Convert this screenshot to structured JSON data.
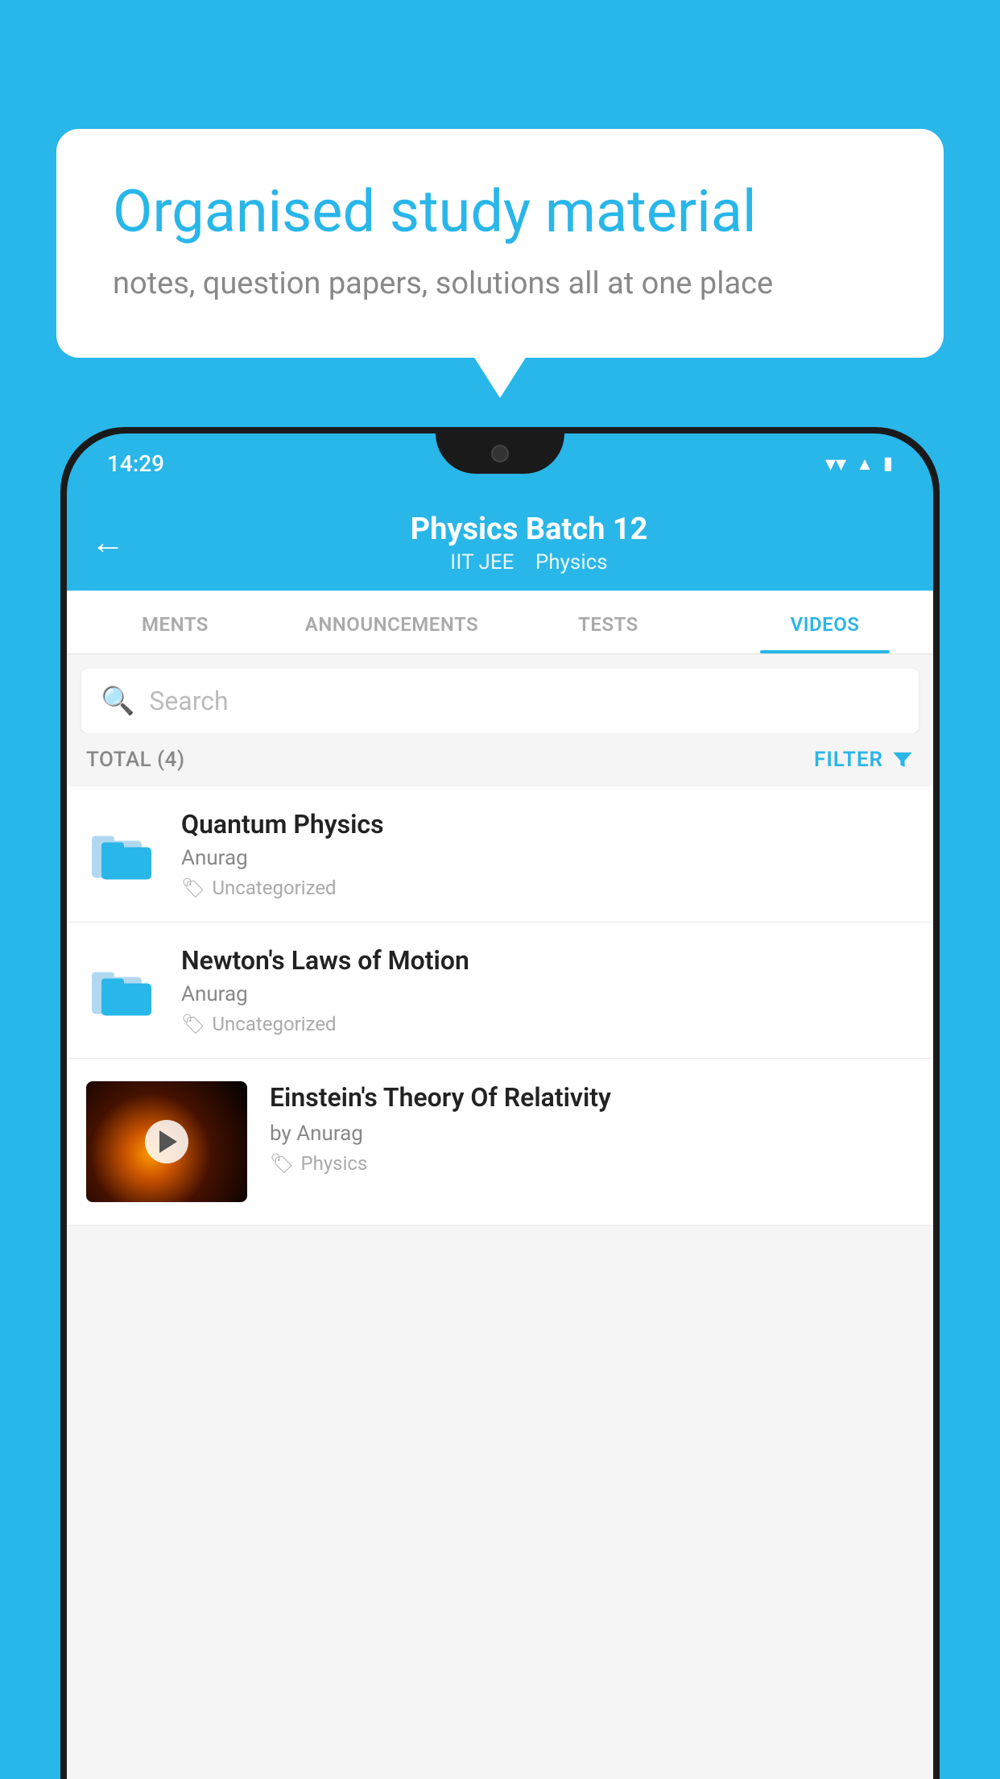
{
  "hero": {
    "title": "Organised study material",
    "subtitle": "notes, question papers, solutions all at one place"
  },
  "status_bar": {
    "time": "14:29"
  },
  "app_header": {
    "title": "Physics Batch 12",
    "tag1": "IIT JEE",
    "tag2": "Physics",
    "back_label": "←"
  },
  "tabs": [
    {
      "label": "MENTS",
      "active": false
    },
    {
      "label": "ANNOUNCEMENTS",
      "active": false
    },
    {
      "label": "TESTS",
      "active": false
    },
    {
      "label": "VIDEOS",
      "active": true
    }
  ],
  "search": {
    "placeholder": "Search"
  },
  "filter": {
    "total_label": "TOTAL (4)",
    "filter_label": "FILTER"
  },
  "videos": [
    {
      "title": "Quantum Physics",
      "author": "Anurag",
      "tag": "Uncategorized",
      "has_thumb": false
    },
    {
      "title": "Newton's Laws of Motion",
      "author": "Anurag",
      "tag": "Uncategorized",
      "has_thumb": false
    },
    {
      "title": "Einstein's Theory Of Relativity",
      "author": "by Anurag",
      "tag": "Physics",
      "has_thumb": true
    }
  ],
  "colors": {
    "brand": "#29b6e8",
    "text_dark": "#222222",
    "text_muted": "#888888"
  }
}
